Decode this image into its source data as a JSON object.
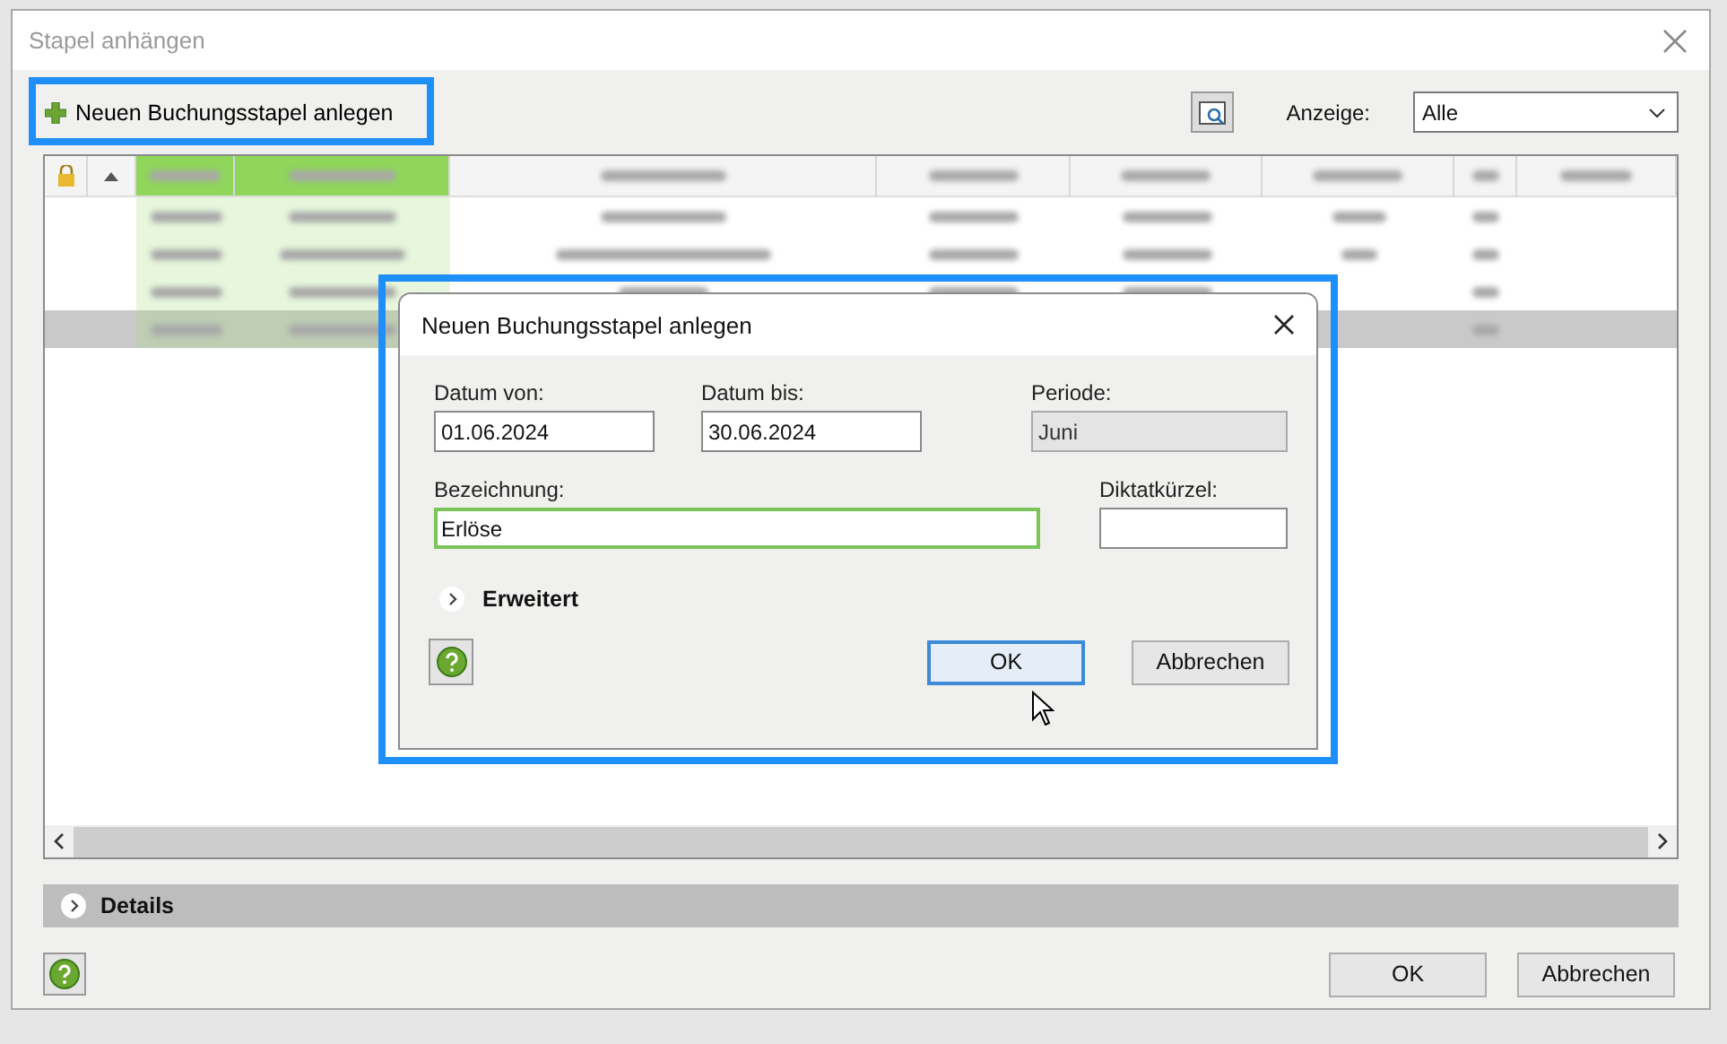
{
  "window": {
    "title": "Stapel anhängen"
  },
  "toolbar": {
    "new_button": "Neuen Buchungsstapel anlegen",
    "display_label": "Anzeige:",
    "display_value": "Alle"
  },
  "table": {
    "rows": [
      {
        "selected": false
      },
      {
        "selected": false
      },
      {
        "selected": false
      },
      {
        "selected": true
      }
    ]
  },
  "details": {
    "label": "Details",
    "expanded": false
  },
  "buttons": [
    {
      "label": "OK"
    },
    {
      "label": "Abbrechen"
    }
  ],
  "modal": {
    "title": "Neuen Buchungsstapel anlegen",
    "fields": [
      {
        "label": "Datum von:",
        "value": "01.06.2024",
        "disabled": false,
        "focused": false
      },
      {
        "label": "Datum bis:",
        "value": "30.06.2024",
        "disabled": false,
        "focused": false
      },
      {
        "label": "Periode:",
        "value": "Juni",
        "disabled": true,
        "focused": false
      },
      {
        "label": "Bezeichnung:",
        "value": "Erlöse",
        "disabled": false,
        "focused": true
      },
      {
        "label": "Diktatkürzel:",
        "disabled": false,
        "focused": false
      }
    ],
    "advanced": {
      "label": "Erweitert",
      "expanded": false
    },
    "buttons": [
      {
        "label": "OK",
        "focused": true
      },
      {
        "label": "Abbrechen",
        "focused": false
      }
    ]
  }
}
